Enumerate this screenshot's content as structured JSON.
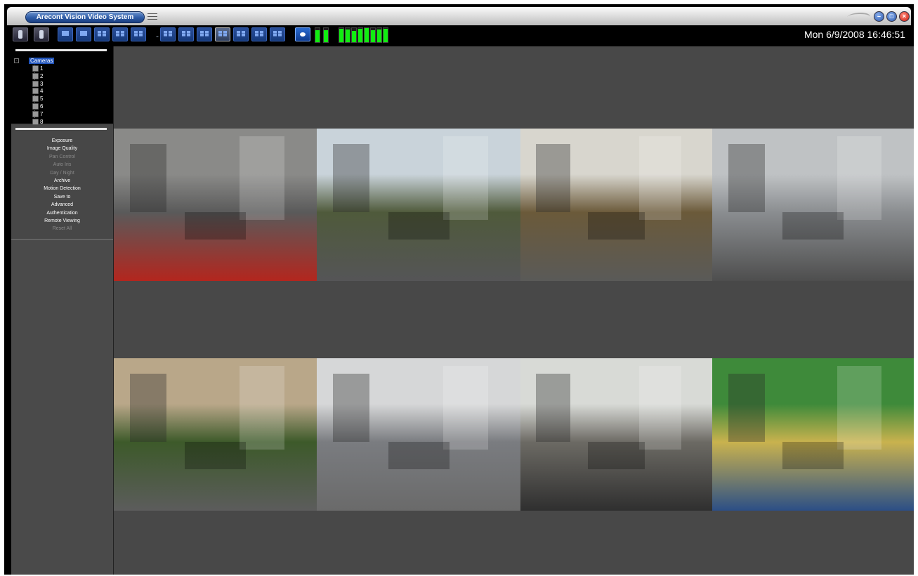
{
  "window": {
    "title": "Arecont Vision Video System"
  },
  "header": {
    "datetime": "Mon 6/9/2008 16:46:51"
  },
  "toolbar": {
    "buttons": [
      {
        "name": "camera-setup-icon",
        "kind": "tool"
      },
      {
        "name": "settings-tool-icon",
        "kind": "tool"
      },
      {
        "name": "layout-1x1-button",
        "kind": "plain"
      },
      {
        "name": "layout-single-button",
        "kind": "plain"
      },
      {
        "name": "layout-2x2-button",
        "kind": "grid"
      },
      {
        "name": "layout-3x3-button",
        "kind": "grid"
      },
      {
        "name": "layout-4x4-button",
        "kind": "grid"
      },
      {
        "name": "layout-a-button",
        "kind": "grid"
      },
      {
        "name": "layout-b-button",
        "kind": "grid"
      },
      {
        "name": "layout-c-button",
        "kind": "grid"
      },
      {
        "name": "layout-2x4-button",
        "kind": "grid",
        "selected": true
      },
      {
        "name": "layout-d-button",
        "kind": "grid"
      },
      {
        "name": "layout-e-button",
        "kind": "grid"
      },
      {
        "name": "layout-f-button",
        "kind": "grid"
      },
      {
        "name": "snapshot-button",
        "kind": "cam"
      }
    ],
    "meters": [
      0.85,
      0.85,
      0.95,
      0.9,
      0.8,
      0.95,
      1.0,
      0.85,
      0.9,
      0.95
    ]
  },
  "tree": {
    "root": "Cameras",
    "cameras": [
      "1",
      "2",
      "3",
      "4",
      "5",
      "6",
      "7",
      "8"
    ]
  },
  "controls": [
    {
      "label": "Exposure",
      "enabled": true
    },
    {
      "label": "Image Quality",
      "enabled": true
    },
    {
      "label": "Pan Control",
      "enabled": false
    },
    {
      "label": "Auto Iris",
      "enabled": false
    },
    {
      "label": "Day / Night",
      "enabled": false
    },
    {
      "label": "Archive",
      "enabled": true
    },
    {
      "label": "Motion Detection",
      "enabled": true
    },
    {
      "label": "Save to",
      "enabled": true
    },
    {
      "label": "Advanced",
      "enabled": true
    },
    {
      "label": "Authentication",
      "enabled": true
    },
    {
      "label": "Remote Viewing",
      "enabled": true
    },
    {
      "label": "Reset All",
      "enabled": false
    }
  ],
  "video": {
    "tiles": [
      {
        "name": "camera-1-feed-parking-lot",
        "colors": [
          "#8a8a88",
          "#5a5a5a",
          "#b3261e"
        ]
      },
      {
        "name": "camera-2-feed-highway",
        "colors": [
          "#c9d3da",
          "#4f5a3b",
          "#555557"
        ]
      },
      {
        "name": "camera-3-feed-cable-car",
        "colors": [
          "#d8d6ce",
          "#6b5a3a",
          "#5a5a58"
        ]
      },
      {
        "name": "camera-4-feed-city-bus",
        "colors": [
          "#bfc2c4",
          "#8a8d90",
          "#4e4e4e"
        ]
      },
      {
        "name": "camera-5-feed-street-palms",
        "colors": [
          "#b9a789",
          "#3d5a2a",
          "#5c5c5c"
        ]
      },
      {
        "name": "camera-6-feed-downtown-intersection",
        "colors": [
          "#d6d7d8",
          "#7a7c80",
          "#6a6a6a"
        ]
      },
      {
        "name": "camera-7-feed-office-cubicles",
        "colors": [
          "#d8dad6",
          "#6c6a64",
          "#2f2f2f"
        ]
      },
      {
        "name": "camera-8-feed-baseball-stadium",
        "colors": [
          "#3e8a3a",
          "#c9b24e",
          "#2c4f86"
        ]
      }
    ]
  }
}
